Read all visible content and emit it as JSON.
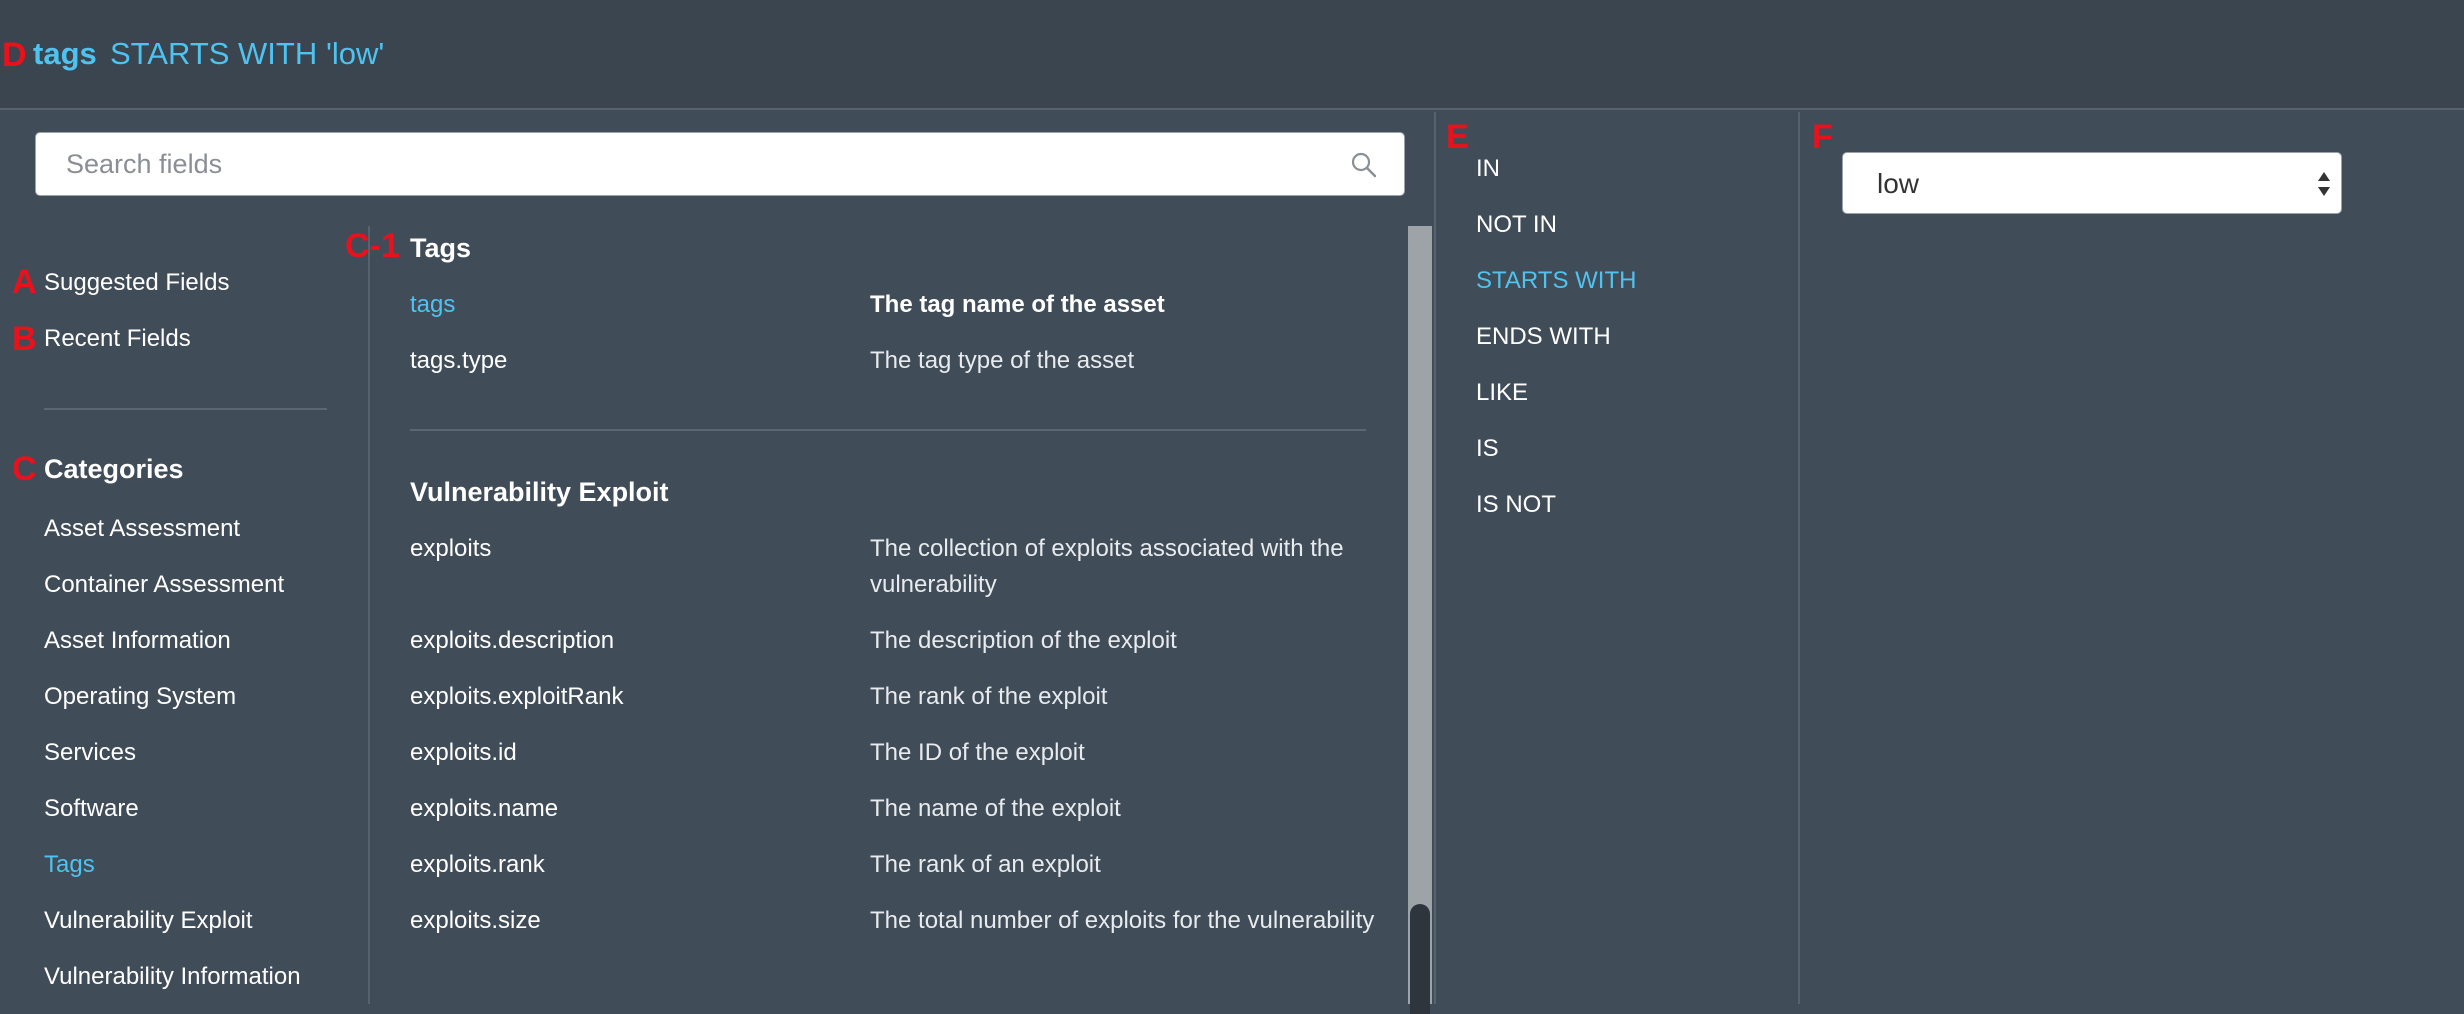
{
  "annotations": {
    "query": "D",
    "suggested": "A",
    "recent": "B",
    "categories": "C",
    "section": "C-1",
    "operators": "E",
    "value": "F"
  },
  "query": {
    "field": "tags",
    "operator": "STARTS WITH",
    "value": "'low'"
  },
  "search": {
    "placeholder": "Search fields",
    "value": ""
  },
  "left_nav": {
    "suggested": "Suggested Fields",
    "recent": "Recent Fields",
    "categories_heading": "Categories",
    "categories": [
      "Asset Assessment",
      "Container Assessment",
      "Asset Information",
      "Operating System",
      "Services",
      "Software",
      "Tags",
      "Vulnerability Exploit",
      "Vulnerability Information"
    ],
    "active_category": "Tags"
  },
  "fields": {
    "sections": [
      {
        "title": "Tags",
        "rows": [
          {
            "name": "tags",
            "description": "The tag name of the asset",
            "selected": true
          },
          {
            "name": "tags.type",
            "description": "The tag type of the asset"
          }
        ]
      },
      {
        "title": "Vulnerability Exploit",
        "rows": [
          {
            "name": "exploits",
            "description": "The collection of exploits associated with the vulnerability"
          },
          {
            "name": "exploits.description",
            "description": "The description of the exploit"
          },
          {
            "name": "exploits.exploitRank",
            "description": "The rank of the exploit"
          },
          {
            "name": "exploits.id",
            "description": "The ID of the exploit"
          },
          {
            "name": "exploits.name",
            "description": "The name of the exploit"
          },
          {
            "name": "exploits.rank",
            "description": "The rank of an exploit"
          },
          {
            "name": "exploits.size",
            "description": "The total number of exploits for the vulnerability"
          }
        ]
      }
    ]
  },
  "operators": {
    "items": [
      "IN",
      "NOT IN",
      "STARTS WITH",
      "ENDS WITH",
      "LIKE",
      "IS",
      "IS NOT"
    ],
    "active": "STARTS WITH"
  },
  "value_select": {
    "selected": "low"
  },
  "colors": {
    "accent": "#4fc3f0",
    "annotation": "#e8121d",
    "background": "#404c58"
  }
}
